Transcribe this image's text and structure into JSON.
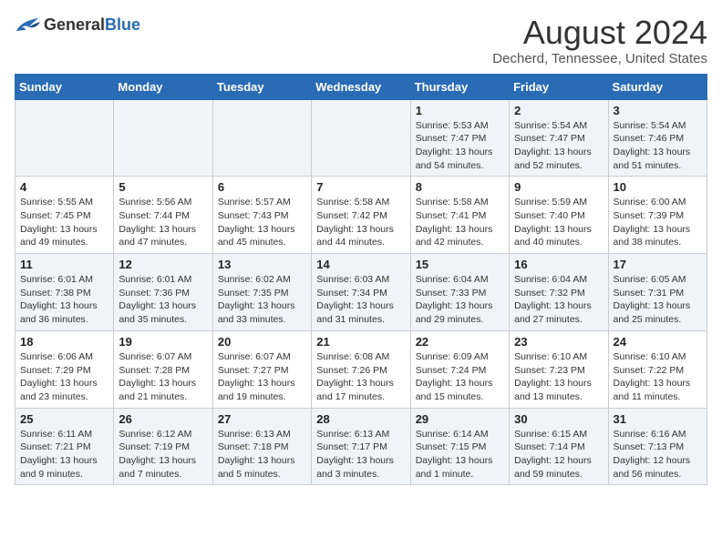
{
  "header": {
    "logo_general": "General",
    "logo_blue": "Blue",
    "main_title": "August 2024",
    "subtitle": "Decherd, Tennessee, United States"
  },
  "calendar": {
    "days_of_week": [
      "Sunday",
      "Monday",
      "Tuesday",
      "Wednesday",
      "Thursday",
      "Friday",
      "Saturday"
    ],
    "weeks": [
      [
        {
          "day": "",
          "info": ""
        },
        {
          "day": "",
          "info": ""
        },
        {
          "day": "",
          "info": ""
        },
        {
          "day": "",
          "info": ""
        },
        {
          "day": "1",
          "info": "Sunrise: 5:53 AM\nSunset: 7:47 PM\nDaylight: 13 hours\nand 54 minutes."
        },
        {
          "day": "2",
          "info": "Sunrise: 5:54 AM\nSunset: 7:47 PM\nDaylight: 13 hours\nand 52 minutes."
        },
        {
          "day": "3",
          "info": "Sunrise: 5:54 AM\nSunset: 7:46 PM\nDaylight: 13 hours\nand 51 minutes."
        }
      ],
      [
        {
          "day": "4",
          "info": "Sunrise: 5:55 AM\nSunset: 7:45 PM\nDaylight: 13 hours\nand 49 minutes."
        },
        {
          "day": "5",
          "info": "Sunrise: 5:56 AM\nSunset: 7:44 PM\nDaylight: 13 hours\nand 47 minutes."
        },
        {
          "day": "6",
          "info": "Sunrise: 5:57 AM\nSunset: 7:43 PM\nDaylight: 13 hours\nand 45 minutes."
        },
        {
          "day": "7",
          "info": "Sunrise: 5:58 AM\nSunset: 7:42 PM\nDaylight: 13 hours\nand 44 minutes."
        },
        {
          "day": "8",
          "info": "Sunrise: 5:58 AM\nSunset: 7:41 PM\nDaylight: 13 hours\nand 42 minutes."
        },
        {
          "day": "9",
          "info": "Sunrise: 5:59 AM\nSunset: 7:40 PM\nDaylight: 13 hours\nand 40 minutes."
        },
        {
          "day": "10",
          "info": "Sunrise: 6:00 AM\nSunset: 7:39 PM\nDaylight: 13 hours\nand 38 minutes."
        }
      ],
      [
        {
          "day": "11",
          "info": "Sunrise: 6:01 AM\nSunset: 7:38 PM\nDaylight: 13 hours\nand 36 minutes."
        },
        {
          "day": "12",
          "info": "Sunrise: 6:01 AM\nSunset: 7:36 PM\nDaylight: 13 hours\nand 35 minutes."
        },
        {
          "day": "13",
          "info": "Sunrise: 6:02 AM\nSunset: 7:35 PM\nDaylight: 13 hours\nand 33 minutes."
        },
        {
          "day": "14",
          "info": "Sunrise: 6:03 AM\nSunset: 7:34 PM\nDaylight: 13 hours\nand 31 minutes."
        },
        {
          "day": "15",
          "info": "Sunrise: 6:04 AM\nSunset: 7:33 PM\nDaylight: 13 hours\nand 29 minutes."
        },
        {
          "day": "16",
          "info": "Sunrise: 6:04 AM\nSunset: 7:32 PM\nDaylight: 13 hours\nand 27 minutes."
        },
        {
          "day": "17",
          "info": "Sunrise: 6:05 AM\nSunset: 7:31 PM\nDaylight: 13 hours\nand 25 minutes."
        }
      ],
      [
        {
          "day": "18",
          "info": "Sunrise: 6:06 AM\nSunset: 7:29 PM\nDaylight: 13 hours\nand 23 minutes."
        },
        {
          "day": "19",
          "info": "Sunrise: 6:07 AM\nSunset: 7:28 PM\nDaylight: 13 hours\nand 21 minutes."
        },
        {
          "day": "20",
          "info": "Sunrise: 6:07 AM\nSunset: 7:27 PM\nDaylight: 13 hours\nand 19 minutes."
        },
        {
          "day": "21",
          "info": "Sunrise: 6:08 AM\nSunset: 7:26 PM\nDaylight: 13 hours\nand 17 minutes."
        },
        {
          "day": "22",
          "info": "Sunrise: 6:09 AM\nSunset: 7:24 PM\nDaylight: 13 hours\nand 15 minutes."
        },
        {
          "day": "23",
          "info": "Sunrise: 6:10 AM\nSunset: 7:23 PM\nDaylight: 13 hours\nand 13 minutes."
        },
        {
          "day": "24",
          "info": "Sunrise: 6:10 AM\nSunset: 7:22 PM\nDaylight: 13 hours\nand 11 minutes."
        }
      ],
      [
        {
          "day": "25",
          "info": "Sunrise: 6:11 AM\nSunset: 7:21 PM\nDaylight: 13 hours\nand 9 minutes."
        },
        {
          "day": "26",
          "info": "Sunrise: 6:12 AM\nSunset: 7:19 PM\nDaylight: 13 hours\nand 7 minutes."
        },
        {
          "day": "27",
          "info": "Sunrise: 6:13 AM\nSunset: 7:18 PM\nDaylight: 13 hours\nand 5 minutes."
        },
        {
          "day": "28",
          "info": "Sunrise: 6:13 AM\nSunset: 7:17 PM\nDaylight: 13 hours\nand 3 minutes."
        },
        {
          "day": "29",
          "info": "Sunrise: 6:14 AM\nSunset: 7:15 PM\nDaylight: 13 hours\nand 1 minute."
        },
        {
          "day": "30",
          "info": "Sunrise: 6:15 AM\nSunset: 7:14 PM\nDaylight: 12 hours\nand 59 minutes."
        },
        {
          "day": "31",
          "info": "Sunrise: 6:16 AM\nSunset: 7:13 PM\nDaylight: 12 hours\nand 56 minutes."
        }
      ]
    ]
  }
}
